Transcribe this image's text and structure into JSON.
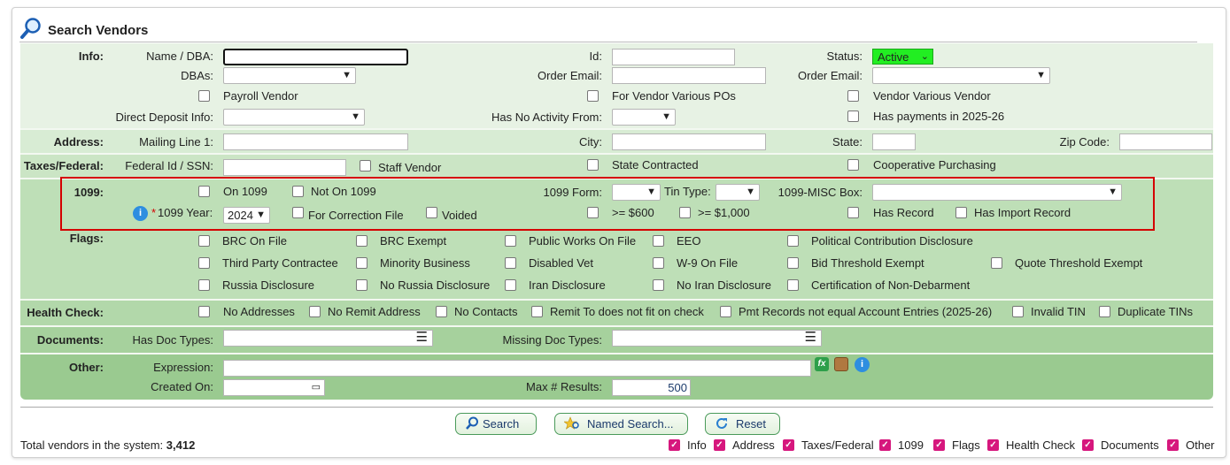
{
  "header": {
    "title": "Search Vendors"
  },
  "info": {
    "section": "Info:",
    "name_dba": "Name / DBA:",
    "id": "Id:",
    "status": "Status:",
    "status_value": "Active",
    "dbas": "DBAs:",
    "order_email": "Order Email:",
    "order_email2": "Order Email:",
    "payroll_vendor": "Payroll Vendor",
    "for_vendor_various": "For Vendor Various POs",
    "vendor_various": "Vendor Various Vendor",
    "direct_deposit": "Direct Deposit Info:",
    "no_activity": "Has No Activity From:",
    "has_payments": "Has payments in 2025-26"
  },
  "address": {
    "section": "Address:",
    "mailing": "Mailing Line 1:",
    "city": "City:",
    "state": "State:",
    "zip": "Zip Code:"
  },
  "taxes": {
    "section": "Taxes/Federal:",
    "fed_id": "Federal Id / SSN:",
    "staff_vendor": "Staff Vendor",
    "state_contracted": "State Contracted",
    "coop": "Cooperative Purchasing"
  },
  "f1099": {
    "section": "1099:",
    "on_1099": "On 1099",
    "not_on_1099": "Not On 1099",
    "form": "1099 Form:",
    "tin_type": "Tin Type:",
    "misc_box": "1099-MISC Box:",
    "year_star": "*",
    "year": "1099 Year:",
    "year_value": "2024",
    "correction": "For Correction File",
    "voided": "Voided",
    "ge600": ">= $600",
    "ge1000": ">= $1,000",
    "has_record": "Has Record",
    "has_import": "Has Import Record"
  },
  "flags": {
    "section": "Flags:",
    "items": [
      "BRC On File",
      "BRC Exempt",
      "Public Works On File",
      "EEO",
      "Political Contribution Disclosure",
      "Third Party Contractee",
      "Minority Business",
      "Disabled Vet",
      "W-9 On File",
      "Bid Threshold Exempt",
      "Quote Threshold Exempt",
      "Russia Disclosure",
      "No Russia Disclosure",
      "Iran Disclosure",
      "No Iran Disclosure",
      "Certification of Non-Debarment"
    ]
  },
  "health": {
    "section": "Health Check:",
    "items": [
      "No Addresses",
      "No Remit Address",
      "No Contacts",
      "Remit To does not fit on check",
      "Pmt Records not equal Account Entries (2025-26)",
      "Invalid TIN",
      "Duplicate TINs"
    ]
  },
  "documents": {
    "section": "Documents:",
    "has_doc": "Has Doc Types:",
    "missing_doc": "Missing Doc Types:"
  },
  "other": {
    "section": "Other:",
    "expression": "Expression:",
    "created_on": "Created On:",
    "max_results": "Max # Results:",
    "max_value": "500"
  },
  "buttons": {
    "search": "Search",
    "named_search": "Named Search...",
    "reset": "Reset"
  },
  "footer": {
    "total_label": "Total vendors in the system:",
    "total_value": "3,412",
    "toggles": [
      "Info",
      "Address",
      "Taxes/Federal",
      "1099",
      "Flags",
      "Health Check",
      "Documents",
      "Other"
    ]
  },
  "colors": {
    "accent": "#d6177d",
    "status_bg": "#22ee22",
    "highlight": "#d40000"
  }
}
